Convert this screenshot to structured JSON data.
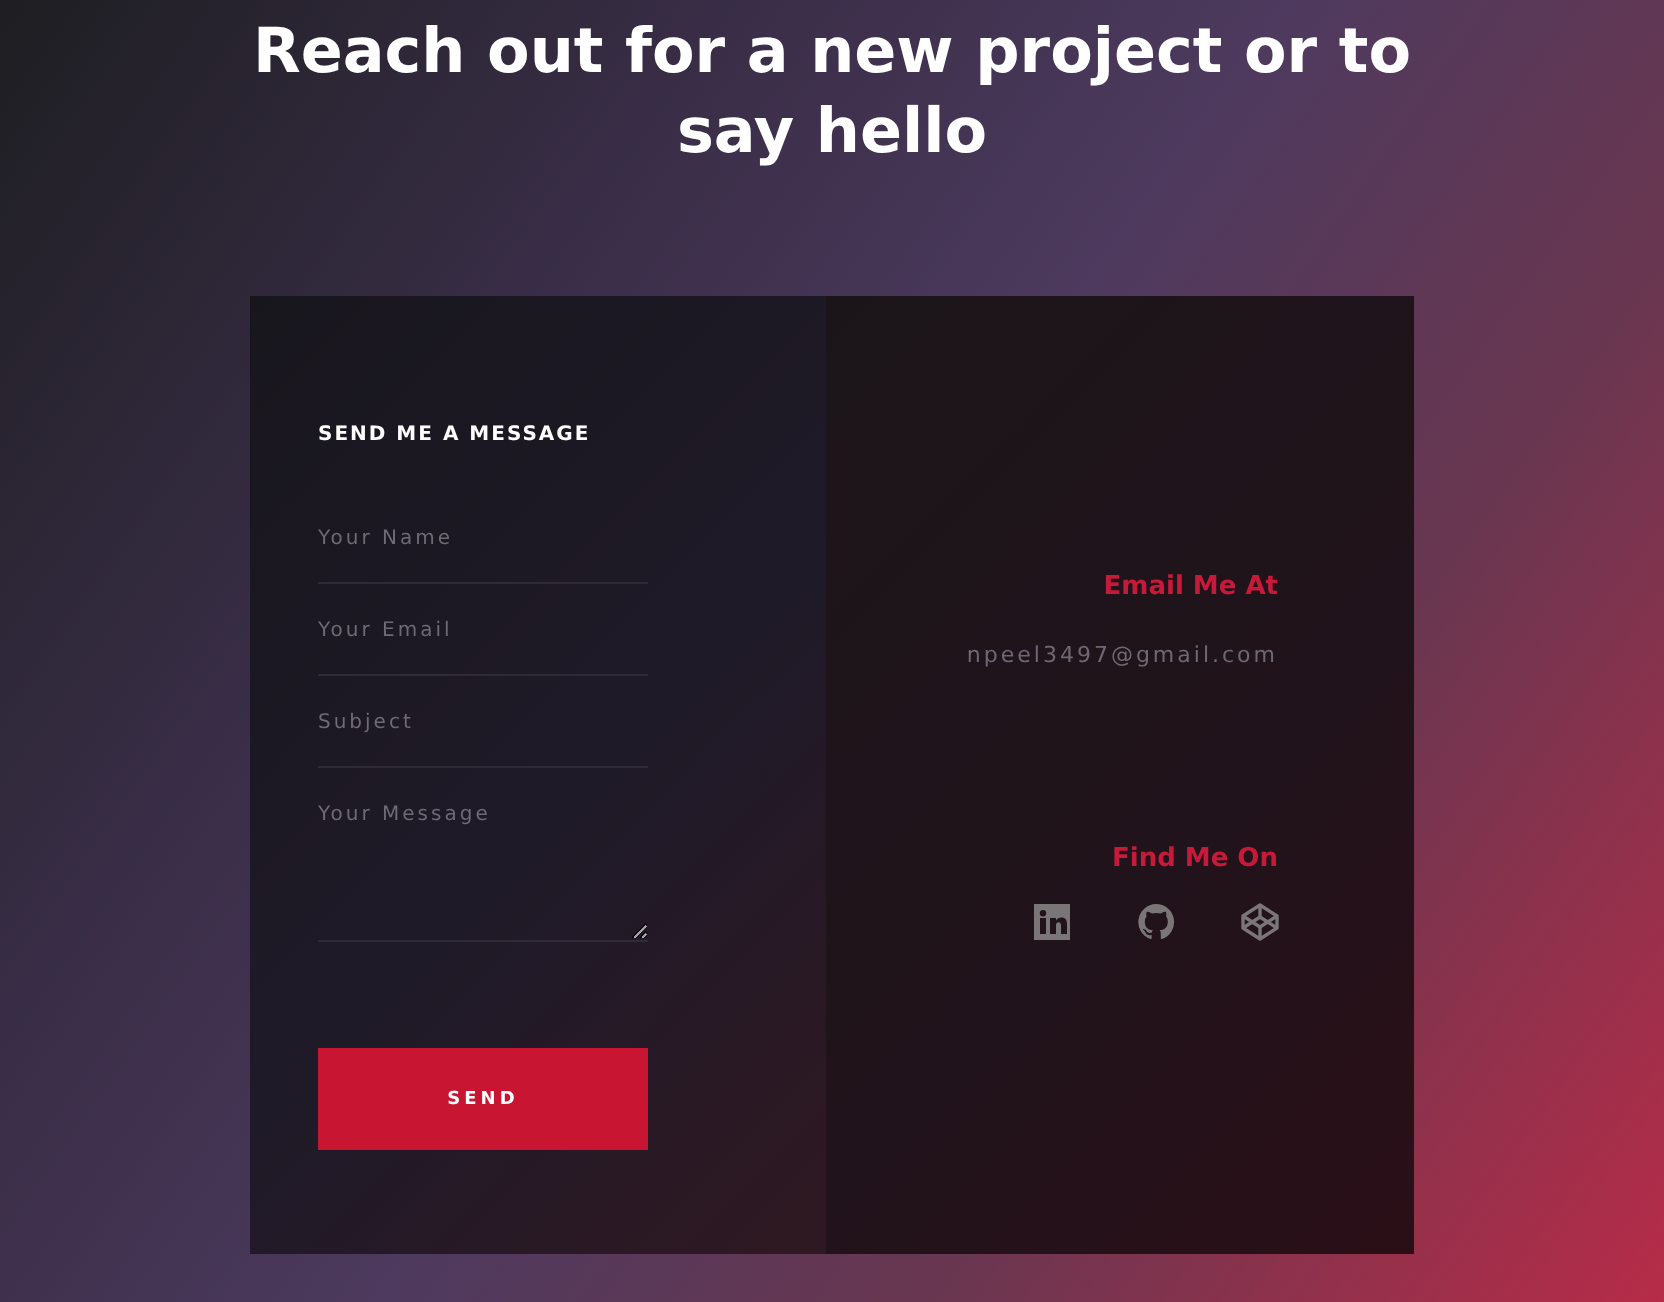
{
  "heading": "Reach out for a new project or to say hello",
  "form": {
    "title": "SEND ME A MESSAGE",
    "fields": [
      {
        "kind": "line",
        "placeholder": "Your Name"
      },
      {
        "kind": "line",
        "placeholder": "Your Email"
      },
      {
        "kind": "line",
        "placeholder": "Subject"
      },
      {
        "kind": "area",
        "placeholder": "Your Message"
      }
    ],
    "button": "SEND"
  },
  "contact": {
    "email_title": "Email Me At",
    "email": "npeel3497@gmail.com",
    "social_title": "Find Me On",
    "links": [
      {
        "kind": "square"
      },
      {
        "kind": "cat"
      },
      {
        "kind": "cube"
      }
    ]
  }
}
